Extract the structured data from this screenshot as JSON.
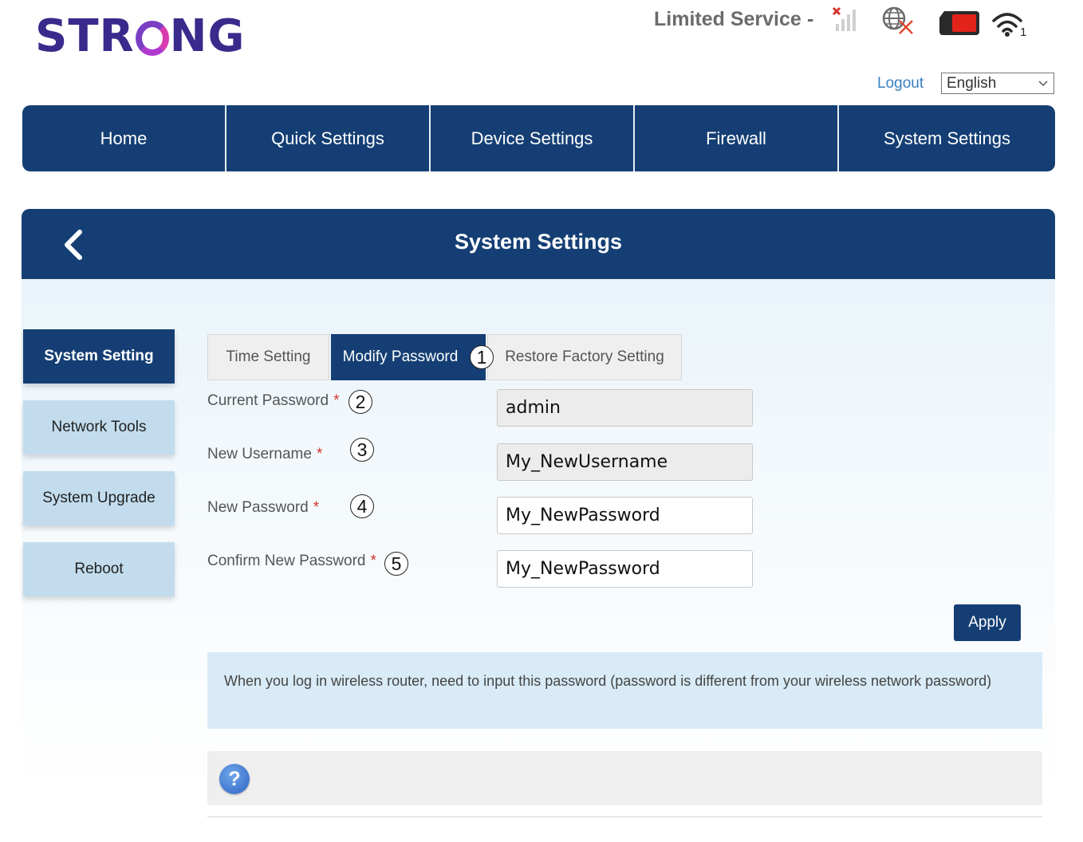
{
  "brand": {
    "logo_text_a": "STR",
    "logo_text_b": "NG"
  },
  "status": {
    "service_text": "Limited Service",
    "separator": "-",
    "icons": [
      "no-signal-icon",
      "no-internet-globe-icon",
      "sim-card-icon",
      "wifi-icon"
    ],
    "wifi_clients": "1"
  },
  "header": {
    "logout_label": "Logout",
    "language_selected": "English"
  },
  "nav": {
    "items": [
      {
        "label": "Home"
      },
      {
        "label": "Quick Settings"
      },
      {
        "label": "Device Settings"
      },
      {
        "label": "Firewall"
      },
      {
        "label": "System Settings"
      }
    ]
  },
  "section": {
    "title": "System Settings"
  },
  "sidebar": {
    "items": [
      {
        "label": "System Setting",
        "active": true
      },
      {
        "label": "Network Tools",
        "active": false
      },
      {
        "label": "System Upgrade",
        "active": false
      },
      {
        "label": "Reboot",
        "active": false
      }
    ]
  },
  "tabs": {
    "items": [
      {
        "label": "Time Setting",
        "active": false
      },
      {
        "label": "Modify Password",
        "active": true
      },
      {
        "label": "Restore Factory Setting",
        "active": false
      }
    ]
  },
  "steps": [
    "1",
    "2",
    "3",
    "4",
    "5"
  ],
  "form": {
    "required_mark": "*",
    "current_password": {
      "label": "Current Password",
      "value": "admin"
    },
    "new_username": {
      "label": "New Username",
      "value": "My_NewUsername"
    },
    "new_password": {
      "label": "New Password",
      "value": "My_NewPassword"
    },
    "confirm_password": {
      "label": "Confirm New Password",
      "value": "My_NewPassword"
    },
    "apply_label": "Apply"
  },
  "info": {
    "text": "When you log in wireless router, need to input this password (password is different from your wireless network password)"
  },
  "help": {
    "glyph": "?"
  },
  "colors": {
    "primary": "#153f74",
    "sidebar_inactive": "#c2dced",
    "info_bg": "#d8ebf6",
    "required": "#d0342c",
    "link": "#3a7fc1"
  }
}
